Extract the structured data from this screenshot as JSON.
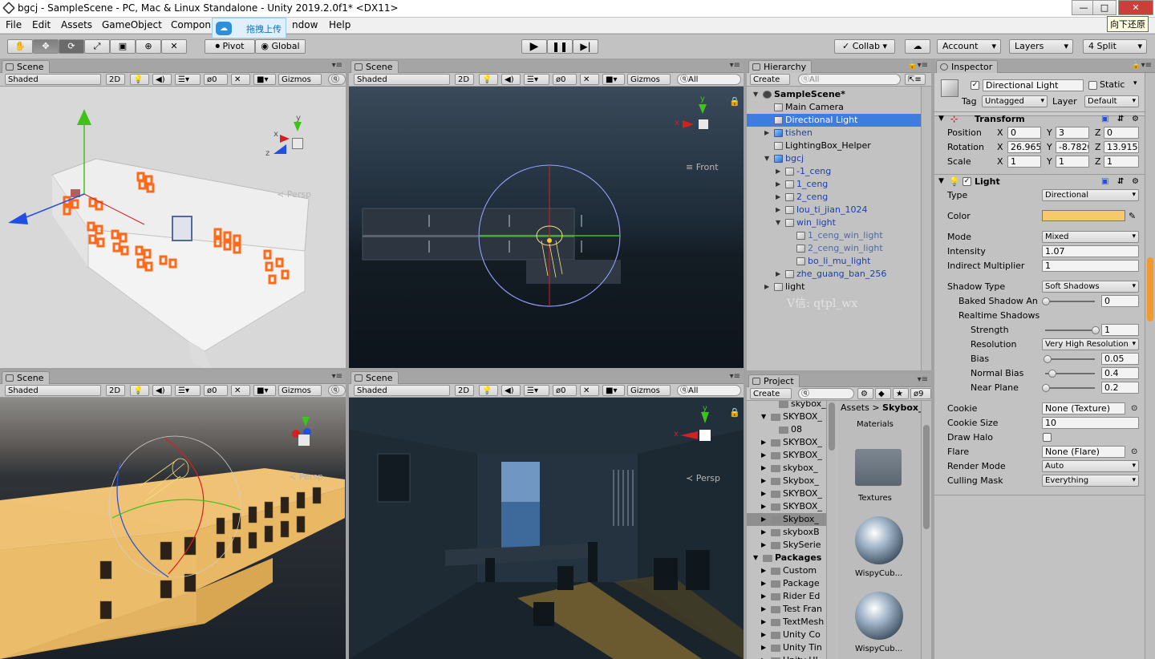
{
  "window": {
    "title": "bgcj - SampleScene - PC, Mac & Linux Standalone - Unity 2019.2.0f1* <DX11>",
    "min_label": "—",
    "max_label": "□",
    "close_label": "✕",
    "tooltip": "向下还原"
  },
  "menubar": [
    "File",
    "Edit",
    "Assets",
    "GameObject",
    "Compon",
    "ndow",
    "Help"
  ],
  "upload_overlay": "拖拽上传",
  "toolbar": {
    "pivot": "Pivot",
    "global": "Global",
    "collab": "Collab ▾",
    "account": "Account",
    "layers": "Layers",
    "layout": "4 Split"
  },
  "scene_views": [
    {
      "tab": "Scene",
      "shading": "Shaded",
      "mode2d": "2D",
      "fx_count": "0",
      "gizmos": "Gizmos",
      "search": "All",
      "camera_label": "Persp"
    },
    {
      "tab": "Scene",
      "shading": "Shaded",
      "mode2d": "2D",
      "fx_count": "0",
      "gizmos": "Gizmos",
      "search": "All",
      "camera_label": "Front"
    },
    {
      "tab": "Scene",
      "shading": "Shaded",
      "mode2d": "2D",
      "fx_count": "0",
      "gizmos": "Gizmos",
      "search": "All",
      "camera_label": "Persp"
    },
    {
      "tab": "Scene",
      "shading": "Shaded",
      "mode2d": "2D",
      "fx_count": "0",
      "gizmos": "Gizmos",
      "search": "All",
      "camera_label": "Persp"
    }
  ],
  "hierarchy": {
    "tab": "Hierarchy",
    "create": "Create",
    "search": "All",
    "watermark": "V信: qtpl_wx",
    "items": [
      {
        "label": "SampleScene*",
        "indent": 0,
        "arrow": "▼",
        "icon": "unity-scene-icon",
        "bold": true
      },
      {
        "label": "Main Camera",
        "indent": 1,
        "arrow": "",
        "icon": "gameobject-icon"
      },
      {
        "label": "Directional Light",
        "indent": 1,
        "arrow": "",
        "icon": "gameobject-icon",
        "selected": true
      },
      {
        "label": "tishen",
        "indent": 1,
        "arrow": "▶",
        "icon": "prefab-icon",
        "prefab": true
      },
      {
        "label": "LightingBox_Helper",
        "indent": 1,
        "arrow": "",
        "icon": "gameobject-icon"
      },
      {
        "label": "bgcj",
        "indent": 1,
        "arrow": "▼",
        "icon": "prefab-icon",
        "prefab": true
      },
      {
        "label": "-1_ceng",
        "indent": 2,
        "arrow": "▶",
        "icon": "gameobject-icon",
        "prefab": true
      },
      {
        "label": "1_ceng",
        "indent": 2,
        "arrow": "▶",
        "icon": "gameobject-icon",
        "prefab": true
      },
      {
        "label": "2_ceng",
        "indent": 2,
        "arrow": "▶",
        "icon": "gameobject-icon",
        "prefab": true
      },
      {
        "label": "lou_ti_jian_1024",
        "indent": 2,
        "arrow": "▶",
        "icon": "gameobject-icon",
        "prefab": true
      },
      {
        "label": "win_light",
        "indent": 2,
        "arrow": "▼",
        "icon": "gameobject-icon",
        "prefab": true
      },
      {
        "label": "1_ceng_win_light",
        "indent": 3,
        "arrow": "",
        "icon": "gameobject-icon",
        "grey": true
      },
      {
        "label": "2_ceng_win_light",
        "indent": 3,
        "arrow": "",
        "icon": "gameobject-icon",
        "grey": true
      },
      {
        "label": "bo_li_mu_light",
        "indent": 3,
        "arrow": "",
        "icon": "gameobject-icon",
        "prefab": true
      },
      {
        "label": "zhe_guang_ban_256",
        "indent": 2,
        "arrow": "▶",
        "icon": "gameobject-icon",
        "prefab": true
      },
      {
        "label": "light",
        "indent": 1,
        "arrow": "▶",
        "icon": "gameobject-icon"
      }
    ]
  },
  "project": {
    "tab": "Project",
    "create": "Create",
    "count": "9",
    "breadcrumb_root": "Assets",
    "breadcrumb_sep": ">",
    "breadcrumb_current": "Skybox_",
    "tree": [
      {
        "label": "skybox_",
        "indent": 2,
        "arrow": ""
      },
      {
        "label": "SKYBOX_",
        "indent": 1,
        "arrow": "▼"
      },
      {
        "label": "08",
        "indent": 2,
        "arrow": ""
      },
      {
        "label": "SKYBOX_",
        "indent": 1,
        "arrow": "▶"
      },
      {
        "label": "SKYBOX_",
        "indent": 1,
        "arrow": "▶"
      },
      {
        "label": "skybox_",
        "indent": 1,
        "arrow": "▶"
      },
      {
        "label": "Skybox_",
        "indent": 1,
        "arrow": "▶"
      },
      {
        "label": "SKYBOX_",
        "indent": 1,
        "arrow": "▶"
      },
      {
        "label": "SKYBOX_",
        "indent": 1,
        "arrow": "▶"
      },
      {
        "label": "Skybox_",
        "indent": 1,
        "arrow": "▶",
        "selected": true
      },
      {
        "label": "skyboxB",
        "indent": 1,
        "arrow": "▶"
      },
      {
        "label": "SkySerie",
        "indent": 1,
        "arrow": "▶"
      },
      {
        "label": "Packages",
        "indent": 0,
        "arrow": "▼",
        "bold": true
      },
      {
        "label": "Custom",
        "indent": 1,
        "arrow": "▶"
      },
      {
        "label": "Package",
        "indent": 1,
        "arrow": "▶"
      },
      {
        "label": "Rider Ed",
        "indent": 1,
        "arrow": "▶"
      },
      {
        "label": "Test Fran",
        "indent": 1,
        "arrow": "▶"
      },
      {
        "label": "TextMesh",
        "indent": 1,
        "arrow": "▶"
      },
      {
        "label": "Unity Co",
        "indent": 1,
        "arrow": "▶"
      },
      {
        "label": "Unity Tin",
        "indent": 1,
        "arrow": "▶"
      },
      {
        "label": "Unity UI",
        "indent": 1,
        "arrow": "▶"
      }
    ],
    "assets": [
      "Materials",
      "Textures",
      "WispyCub...",
      "WispyCub..."
    ]
  },
  "inspector": {
    "tab": "Inspector",
    "object_name": "Directional Light",
    "static_label": "Static",
    "tag_label": "Tag",
    "tag_value": "Untagged",
    "layer_label": "Layer",
    "layer_value": "Default",
    "transform": {
      "title": "Transform",
      "position": {
        "label": "Position",
        "x": "0",
        "y": "3",
        "z": "0"
      },
      "rotation": {
        "label": "Rotation",
        "x": "26.965",
        "y": "-8.7820",
        "z": "13.915"
      },
      "scale": {
        "label": "Scale",
        "x": "1",
        "y": "1",
        "z": "1"
      }
    },
    "light": {
      "title": "Light",
      "type_label": "Type",
      "type_value": "Directional",
      "color_label": "Color",
      "color_hex": "#f6c96a",
      "mode_label": "Mode",
      "mode_value": "Mixed",
      "intensity_label": "Intensity",
      "intensity_value": "1.07",
      "indirect_label": "Indirect Multiplier",
      "indirect_value": "1",
      "shadow_type_label": "Shadow Type",
      "shadow_type_value": "Soft Shadows",
      "baked_label": "Baked Shadow An",
      "baked_value": "0",
      "baked_level": 0,
      "realtime_label": "Realtime Shadows",
      "strength_label": "Strength",
      "strength_value": "1",
      "strength_level": 1,
      "resolution_label": "Resolution",
      "resolution_value": "Very High Resolution",
      "bias_label": "Bias",
      "bias_value": "0.05",
      "bias_level": 0.025,
      "normal_bias_label": "Normal Bias",
      "normal_bias_value": "0.4",
      "normal_bias_level": 0.13,
      "near_plane_label": "Near Plane",
      "near_plane_value": "0.2",
      "near_plane_level": 0.0,
      "cookie_label": "Cookie",
      "cookie_value": "None (Texture)",
      "cookie_size_label": "Cookie Size",
      "cookie_size_value": "10",
      "draw_halo_label": "Draw Halo",
      "flare_label": "Flare",
      "flare_value": "None (Flare)",
      "render_mode_label": "Render Mode",
      "render_mode_value": "Auto",
      "culling_label": "Culling Mask",
      "culling_value": "Everything"
    }
  },
  "colors": {
    "selection": "#3e7ce0",
    "panel": "#c2c2c2",
    "light_color": "#f6c96a",
    "gizmo_x": "#d42020",
    "gizmo_y": "#3fc21a",
    "gizmo_z": "#2150e0"
  }
}
